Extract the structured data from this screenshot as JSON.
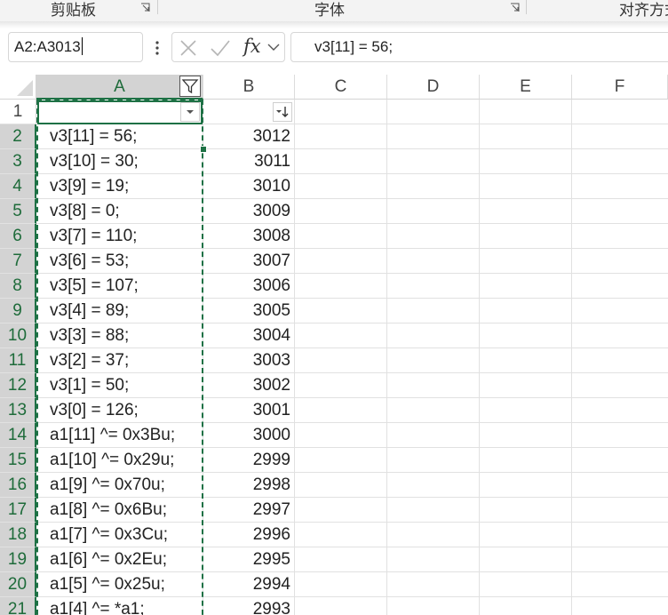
{
  "ribbon": {
    "groups": [
      "剪贴板",
      "字体",
      "对齐方式"
    ]
  },
  "formula_bar": {
    "name_box": "A2:A3013",
    "fx_label": "fx",
    "formula": "v3[11] = 56;"
  },
  "columns": [
    "A",
    "B",
    "C",
    "D",
    "E",
    "F"
  ],
  "rows": [
    {
      "n": "1",
      "a": "",
      "b": ""
    },
    {
      "n": "2",
      "a": "v3[11] = 56;",
      "b": "3012"
    },
    {
      "n": "3",
      "a": "v3[10] = 30;",
      "b": "3011"
    },
    {
      "n": "4",
      "a": "v3[9] = 19;",
      "b": "3010"
    },
    {
      "n": "5",
      "a": "v3[8] = 0;",
      "b": "3009"
    },
    {
      "n": "6",
      "a": "v3[7] = 110;",
      "b": "3008"
    },
    {
      "n": "7",
      "a": "v3[6] = 53;",
      "b": "3007"
    },
    {
      "n": "8",
      "a": "v3[5] = 107;",
      "b": "3006"
    },
    {
      "n": "9",
      "a": "v3[4] = 89;",
      "b": "3005"
    },
    {
      "n": "10",
      "a": "v3[3] = 88;",
      "b": "3004"
    },
    {
      "n": "11",
      "a": "v3[2] = 37;",
      "b": "3003"
    },
    {
      "n": "12",
      "a": "v3[1] = 50;",
      "b": "3002"
    },
    {
      "n": "13",
      "a": "v3[0] = 126;",
      "b": "3001"
    },
    {
      "n": "14",
      "a": "a1[11] ^= 0x3Bu;",
      "b": "3000"
    },
    {
      "n": "15",
      "a": "a1[10] ^= 0x29u;",
      "b": "2999"
    },
    {
      "n": "16",
      "a": "a1[9] ^= 0x70u;",
      "b": "2998"
    },
    {
      "n": "17",
      "a": "a1[8] ^= 0x6Bu;",
      "b": "2997"
    },
    {
      "n": "18",
      "a": "a1[7] ^= 0x3Cu;",
      "b": "2996"
    },
    {
      "n": "19",
      "a": "a1[6] ^= 0x2Eu;",
      "b": "2995"
    },
    {
      "n": "20",
      "a": "a1[5] ^= 0x25u;",
      "b": "2994"
    },
    {
      "n": "21",
      "a": "a1[4] ^= *a1;",
      "b": "2993"
    }
  ],
  "colors": {
    "accent": "#1e7145",
    "selected_header": "#d3d3d3",
    "gridline": "#e1e1e1"
  },
  "icons": {
    "cancel": "close-icon",
    "enter": "check-icon",
    "filter_active": "funnel-icon",
    "filter_dropdown": "dropdown-arrow-icon",
    "sort_desc": "sort-descending-icon"
  }
}
